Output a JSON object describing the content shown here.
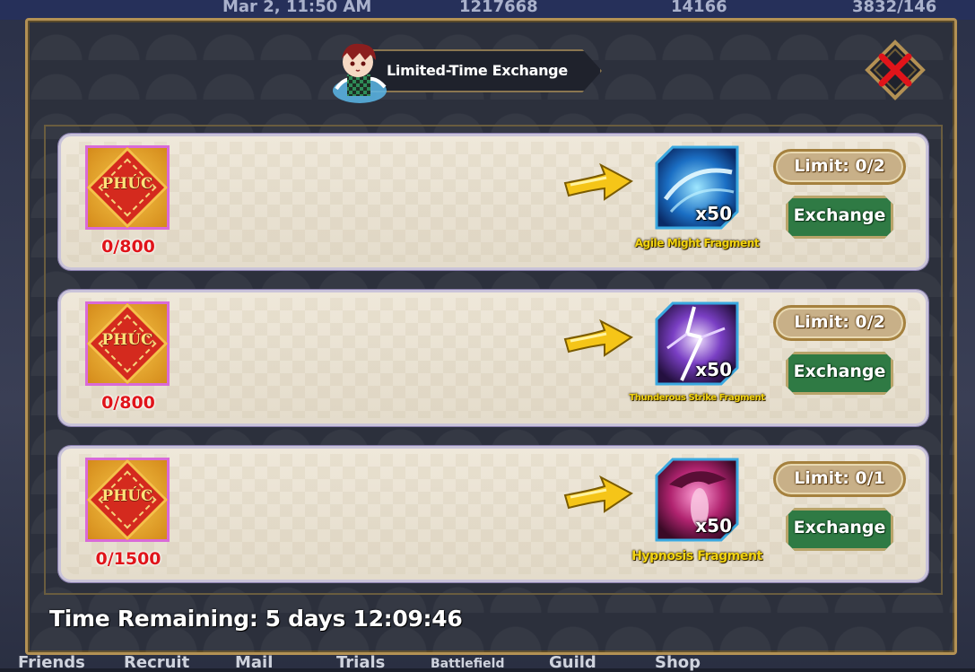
{
  "background": {
    "top_bar": {
      "date": "Mar 2, 11:50 AM",
      "coins": "1217668",
      "gems": "14166",
      "stamina": "3832/146"
    },
    "bottom_tabs": [
      "Friends",
      "Recruit",
      "Mail",
      "Trials",
      "Battlefield",
      "Guild",
      "Shop"
    ]
  },
  "modal": {
    "title": "Limited-Time Exchange",
    "time_remaining_label": "Time Remaining:",
    "time_remaining_value": "5 days 12:09:46",
    "exchanges": [
      {
        "cost_icon": "phuc-token-icon",
        "cost_label": "PHÚC",
        "cost_count": "0/800",
        "reward_icon": "agile-might-fragment-icon",
        "reward_qty": "x50",
        "reward_name": "Agile Might Fragment",
        "limit": "Limit: 0/2",
        "button": "Exchange"
      },
      {
        "cost_icon": "phuc-token-icon",
        "cost_label": "PHÚC",
        "cost_count": "0/800",
        "reward_icon": "thunderous-strike-fragment-icon",
        "reward_qty": "x50",
        "reward_name": "Thunderous Strike Fragment",
        "limit": "Limit: 0/2",
        "button": "Exchange"
      },
      {
        "cost_icon": "phuc-token-icon",
        "cost_label": "PHÚC",
        "cost_count": "0/1500",
        "reward_icon": "hypnosis-fragment-icon",
        "reward_qty": "x50",
        "reward_name": "Hypnosis Fragment",
        "limit": "Limit: 0/1",
        "button": "Exchange"
      }
    ]
  },
  "colors": {
    "frame_gold": "#b39154",
    "button_green": "#2f7a44",
    "cost_red": "#e0141a",
    "reward_name_yellow": "#f2d410",
    "close_red": "#e0141a"
  }
}
